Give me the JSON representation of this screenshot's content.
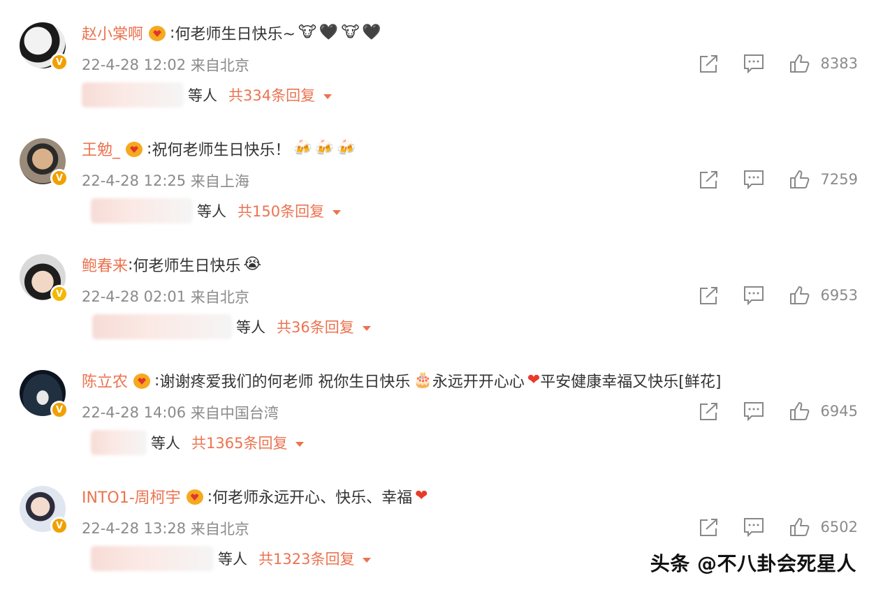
{
  "comments": [
    {
      "username": "赵小棠啊",
      "separator": ":",
      "text": "何老师生日快乐~",
      "emojis": [
        "🐮",
        "🖤",
        "🐮",
        "🖤"
      ],
      "time": "22-4-28 12:02",
      "location": "来自北京",
      "likes": "8383",
      "replies_others": "等人",
      "replies_total": "共334条回复",
      "badge": "V",
      "badge_color": "#f0a000"
    },
    {
      "username": "王勉_",
      "separator": ":",
      "text": "祝何老师生日快乐！",
      "emojis": [
        "🍻",
        "🍻",
        "🍻"
      ],
      "time": "22-4-28 12:25",
      "location": "来自上海",
      "likes": "7259",
      "replies_others": "等人",
      "replies_total": "共150条回复",
      "badge": "V",
      "badge_color": "#f0a000"
    },
    {
      "username": "鲍春来",
      "separator": ":",
      "text": "何老师生日快乐",
      "emojis": [
        "😭"
      ],
      "time": "22-4-28 02:01",
      "location": "来自北京",
      "likes": "6953",
      "replies_others": "等人",
      "replies_total": "共36条回复",
      "badge": "V",
      "badge_color": "#f4b800"
    },
    {
      "username": "陈立农",
      "separator": ":",
      "text": "谢谢疼爱我们的何老师 祝你生日快乐",
      "text2": " 永远开开心心",
      "text3": " 平安健康幸福又快乐[鲜花]",
      "emojis": [
        "🎂"
      ],
      "heart": "❤",
      "time": "22-4-28 14:06",
      "location": "来自中国台湾",
      "likes": "6945",
      "replies_others": "等人",
      "replies_total": "共1365条回复",
      "badge": "V",
      "badge_color": "#f0a000"
    },
    {
      "username": "INTO1-周柯宇",
      "separator": ":",
      "text": "何老师永远开心、快乐、幸福",
      "heart": "❤",
      "time": "22-4-28 13:28",
      "location": "来自北京",
      "likes": "6502",
      "replies_others": "等人",
      "replies_total": "共1323条回复",
      "badge": "V",
      "badge_color": "#f0a000"
    }
  ],
  "icons": {
    "share": "share-icon",
    "comment": "comment-icon",
    "like": "thumbs-up-icon",
    "member": "crown-icon"
  },
  "colors": {
    "username": "#eb7350",
    "meta": "#8a8a8a",
    "text": "#333333"
  },
  "watermark": "头条 @不八卦会死星人"
}
